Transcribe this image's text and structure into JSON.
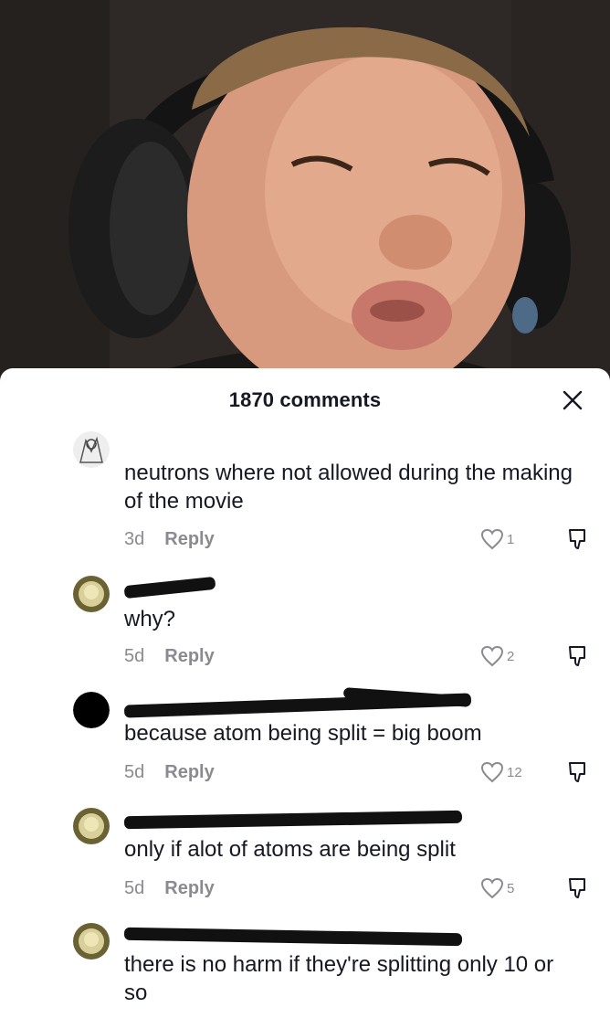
{
  "header": {
    "comments_count": "1870 comments"
  },
  "icons": {
    "close": "close-icon",
    "like": "heart-outline-icon",
    "dislike": "thumbs-down-outline-icon"
  },
  "colors": {
    "text_primary": "#161823",
    "text_secondary": "#8a8b91"
  },
  "comments": [
    {
      "username": "",
      "text": "neutrons where not allowed during the making of the movie",
      "age": "3d",
      "reply_label": "Reply",
      "likes": "1"
    },
    {
      "username": "",
      "text": "why?",
      "age": "5d",
      "reply_label": "Reply",
      "likes": "2"
    },
    {
      "username": "",
      "text": "because atom being split = big boom",
      "age": "5d",
      "reply_label": "Reply",
      "likes": "12"
    },
    {
      "username": "",
      "text": "only if alot of atoms are being split",
      "age": "5d",
      "reply_label": "Reply",
      "likes": "5"
    },
    {
      "username": "",
      "text": "there is no harm if they're splitting only 10 or so"
    }
  ]
}
